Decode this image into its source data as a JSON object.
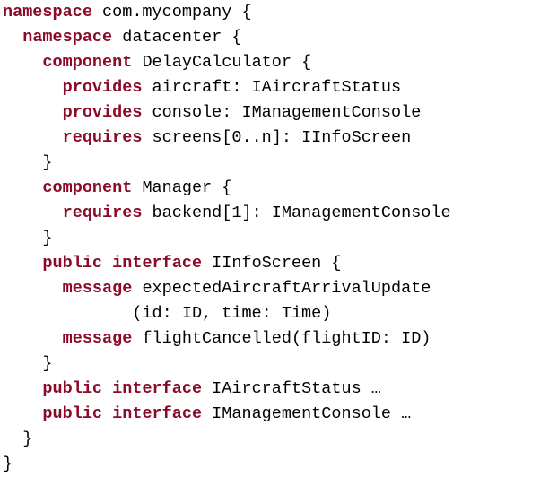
{
  "code": {
    "lines": [
      {
        "indent": "",
        "segments": [
          {
            "kw": true,
            "text": "namespace"
          },
          {
            "kw": false,
            "text": " com.mycompany {"
          }
        ]
      },
      {
        "indent": "  ",
        "segments": [
          {
            "kw": true,
            "text": "namespace"
          },
          {
            "kw": false,
            "text": " datacenter {"
          }
        ]
      },
      {
        "indent": "    ",
        "segments": [
          {
            "kw": true,
            "text": "component"
          },
          {
            "kw": false,
            "text": " DelayCalculator {"
          }
        ]
      },
      {
        "indent": "      ",
        "segments": [
          {
            "kw": true,
            "text": "provides"
          },
          {
            "kw": false,
            "text": " aircraft: IAircraftStatus"
          }
        ]
      },
      {
        "indent": "      ",
        "segments": [
          {
            "kw": true,
            "text": "provides"
          },
          {
            "kw": false,
            "text": " console: IManagementConsole"
          }
        ]
      },
      {
        "indent": "      ",
        "segments": [
          {
            "kw": true,
            "text": "requires"
          },
          {
            "kw": false,
            "text": " screens[0..n]: IInfoScreen"
          }
        ]
      },
      {
        "indent": "    ",
        "segments": [
          {
            "kw": false,
            "text": "}"
          }
        ]
      },
      {
        "indent": "    ",
        "segments": [
          {
            "kw": true,
            "text": "component"
          },
          {
            "kw": false,
            "text": " Manager {"
          }
        ]
      },
      {
        "indent": "      ",
        "segments": [
          {
            "kw": true,
            "text": "requires"
          },
          {
            "kw": false,
            "text": " backend[1]: IManagementConsole"
          }
        ]
      },
      {
        "indent": "    ",
        "segments": [
          {
            "kw": false,
            "text": "}"
          }
        ]
      },
      {
        "indent": "    ",
        "segments": [
          {
            "kw": true,
            "text": "public interface"
          },
          {
            "kw": false,
            "text": " IInfoScreen {"
          }
        ]
      },
      {
        "indent": "      ",
        "segments": [
          {
            "kw": true,
            "text": "message"
          },
          {
            "kw": false,
            "text": " expectedAircraftArrivalUpdate"
          }
        ]
      },
      {
        "indent": "             ",
        "segments": [
          {
            "kw": false,
            "text": "(id: ID, time: Time)"
          }
        ]
      },
      {
        "indent": "      ",
        "segments": [
          {
            "kw": true,
            "text": "message"
          },
          {
            "kw": false,
            "text": " flightCancelled(flightID: ID)"
          }
        ]
      },
      {
        "indent": "    ",
        "segments": [
          {
            "kw": false,
            "text": "}"
          }
        ]
      },
      {
        "indent": "    ",
        "segments": [
          {
            "kw": true,
            "text": "public interface"
          },
          {
            "kw": false,
            "text": " IAircraftStatus …"
          }
        ]
      },
      {
        "indent": "    ",
        "segments": [
          {
            "kw": true,
            "text": "public interface"
          },
          {
            "kw": false,
            "text": " IManagementConsole …"
          }
        ]
      },
      {
        "indent": "  ",
        "segments": [
          {
            "kw": false,
            "text": "}"
          }
        ]
      },
      {
        "indent": "",
        "segments": [
          {
            "kw": false,
            "text": "}"
          }
        ]
      }
    ]
  },
  "colors": {
    "keyword": "#8b0a2a",
    "text": "#000000",
    "background": "#ffffff"
  }
}
